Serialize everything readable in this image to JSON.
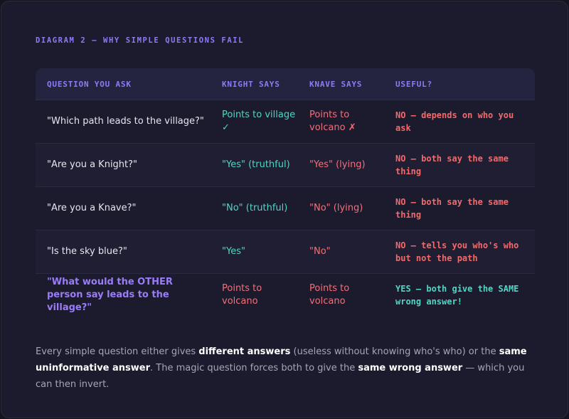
{
  "eyebrow": "DIAGRAM 2 — WHY SIMPLE QUESTIONS FAIL",
  "colors": {
    "accent": "#8b7cf6",
    "knight": "#4fd6c4",
    "knave": "#f0707a",
    "no": "#f26a6a",
    "yes": "#4fd6c4"
  },
  "table": {
    "headers": {
      "question": "QUESTION YOU ASK",
      "knight": "KNIGHT SAYS",
      "knave": "KNAVE SAYS",
      "useful": "USEFUL?"
    },
    "rows": [
      {
        "question": "\"Which path leads to the village?\"",
        "knight": "Points to village ✓",
        "knave": "Points to volcano ✗",
        "useful": "NO — depends on who you ask"
      },
      {
        "question": "\"Are you a Knight?\"",
        "knight": "\"Yes\" (truthful)",
        "knave": "\"Yes\" (lying)",
        "useful": "NO — both say the same thing"
      },
      {
        "question": "\"Are you a Knave?\"",
        "knight": "\"No\" (truthful)",
        "knave": "\"No\" (lying)",
        "useful": "NO — both say the same thing"
      },
      {
        "question": "\"Is the sky blue?\"",
        "knight": "\"Yes\"",
        "knave": "\"No\"",
        "useful": "NO — tells you who's who but not the path"
      },
      {
        "question": "\"What would the OTHER person say leads to the village?\"",
        "knight": "Points to volcano",
        "knave": "Points to volcano",
        "useful": "YES — both give the SAME wrong answer!"
      }
    ]
  },
  "note": {
    "p1": "Every simple question either gives ",
    "b1": "different answers",
    "p2": " (useless without knowing who's who) or the ",
    "b2": "same uninformative answer",
    "p3": ". The magic question forces both to give the ",
    "b3": "same wrong answer",
    "p4": " — which you can then invert."
  }
}
